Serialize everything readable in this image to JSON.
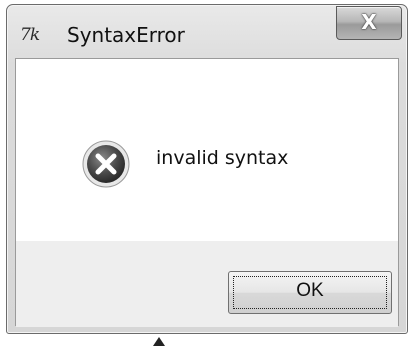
{
  "window": {
    "title": "SyntaxError",
    "app_icon_glyph": "7k",
    "app_icon": "tk-feather-icon",
    "close_glyph": "X"
  },
  "dialog": {
    "icon": "error-icon",
    "message": "invalid syntax",
    "ok_label": "OK"
  },
  "colors": {
    "error_red": "#cc2a2a",
    "frame_gray": "#d9d9d9",
    "button_area_gray": "#eeeeee"
  }
}
